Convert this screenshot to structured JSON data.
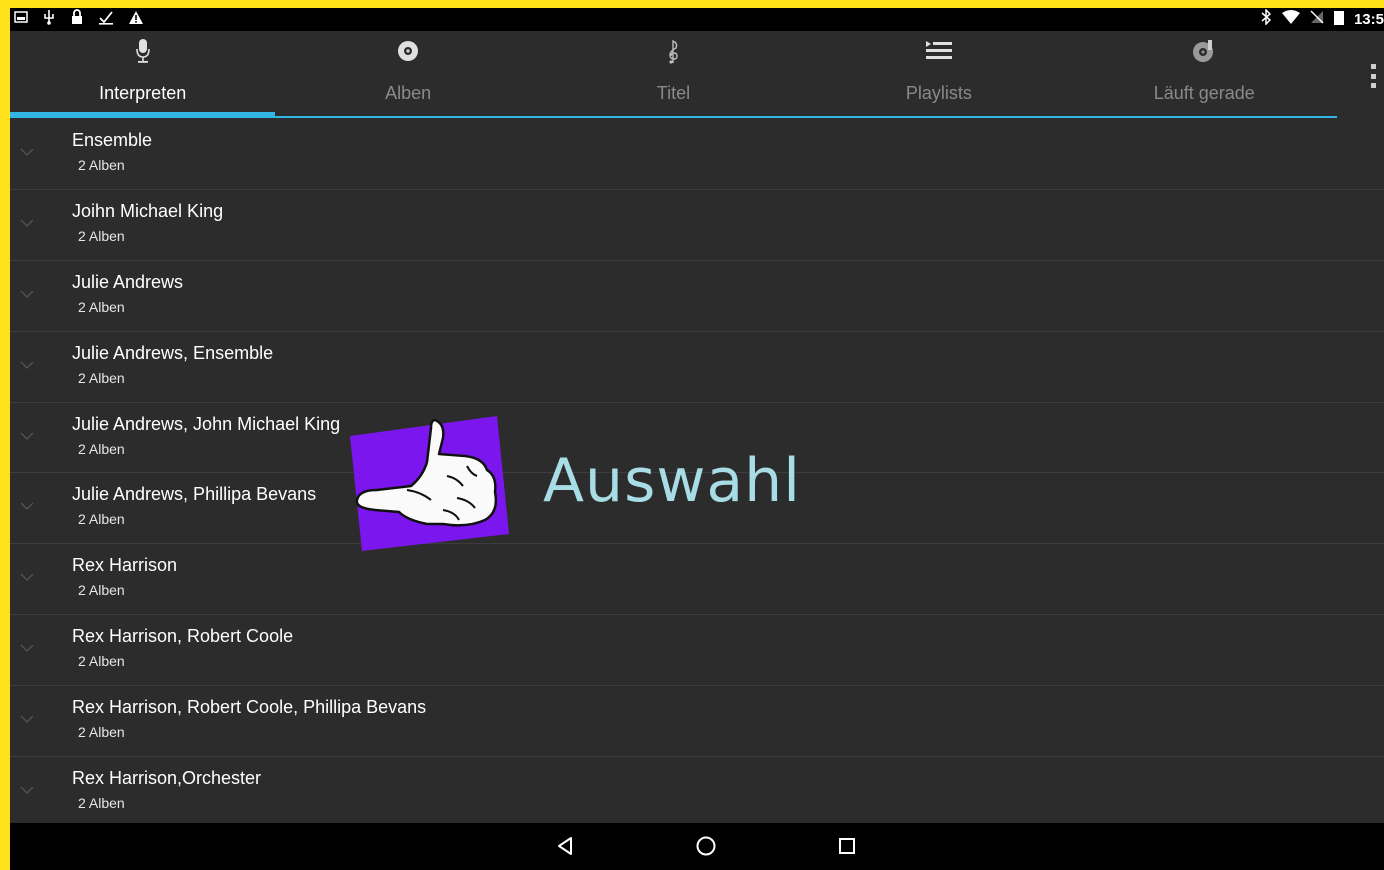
{
  "status_bar": {
    "left_icons": [
      "gallery-icon",
      "usb-icon",
      "lock-icon",
      "download-icon",
      "warning-icon"
    ],
    "right_icons": [
      "bluetooth-icon",
      "wifi-icon",
      "no-signal-icon",
      "battery-icon"
    ],
    "time": "13:5"
  },
  "tabs": [
    {
      "label": "Interpreten",
      "icon": "microphone-icon",
      "active": true
    },
    {
      "label": "Alben",
      "icon": "album-icon",
      "active": false
    },
    {
      "label": "Titel",
      "icon": "music-note-icon",
      "active": false
    },
    {
      "label": "Playlists",
      "icon": "playlist-icon",
      "active": false
    },
    {
      "label": "Läuft gerade",
      "icon": "now-playing-icon",
      "active": false
    }
  ],
  "accent_color": "#33b5e5",
  "artists": [
    {
      "name": "Ensemble",
      "albums": "2 Alben"
    },
    {
      "name": "Joihn Michael King",
      "albums": "2 Alben"
    },
    {
      "name": "Julie Andrews",
      "albums": "2 Alben"
    },
    {
      "name": "Julie Andrews, Ensemble",
      "albums": "2 Alben"
    },
    {
      "name": "Julie Andrews, John Michael King",
      "albums": "2 Alben"
    },
    {
      "name": "Julie Andrews, Phillipa Bevans",
      "albums": "2 Alben"
    },
    {
      "name": "Rex Harrison",
      "albums": "2 Alben"
    },
    {
      "name": "Rex Harrison, Robert Coole",
      "albums": "2 Alben"
    },
    {
      "name": "Rex Harrison, Robert Coole, Phillipa Bevans",
      "albums": "2 Alben"
    },
    {
      "name": "Rex Harrison,Orchester",
      "albums": "2 Alben"
    }
  ],
  "overlay": {
    "text": "Auswahl",
    "icon": "pointing-hand-icon"
  },
  "navbar": {
    "buttons": [
      "back-icon",
      "home-icon",
      "recents-icon"
    ]
  }
}
